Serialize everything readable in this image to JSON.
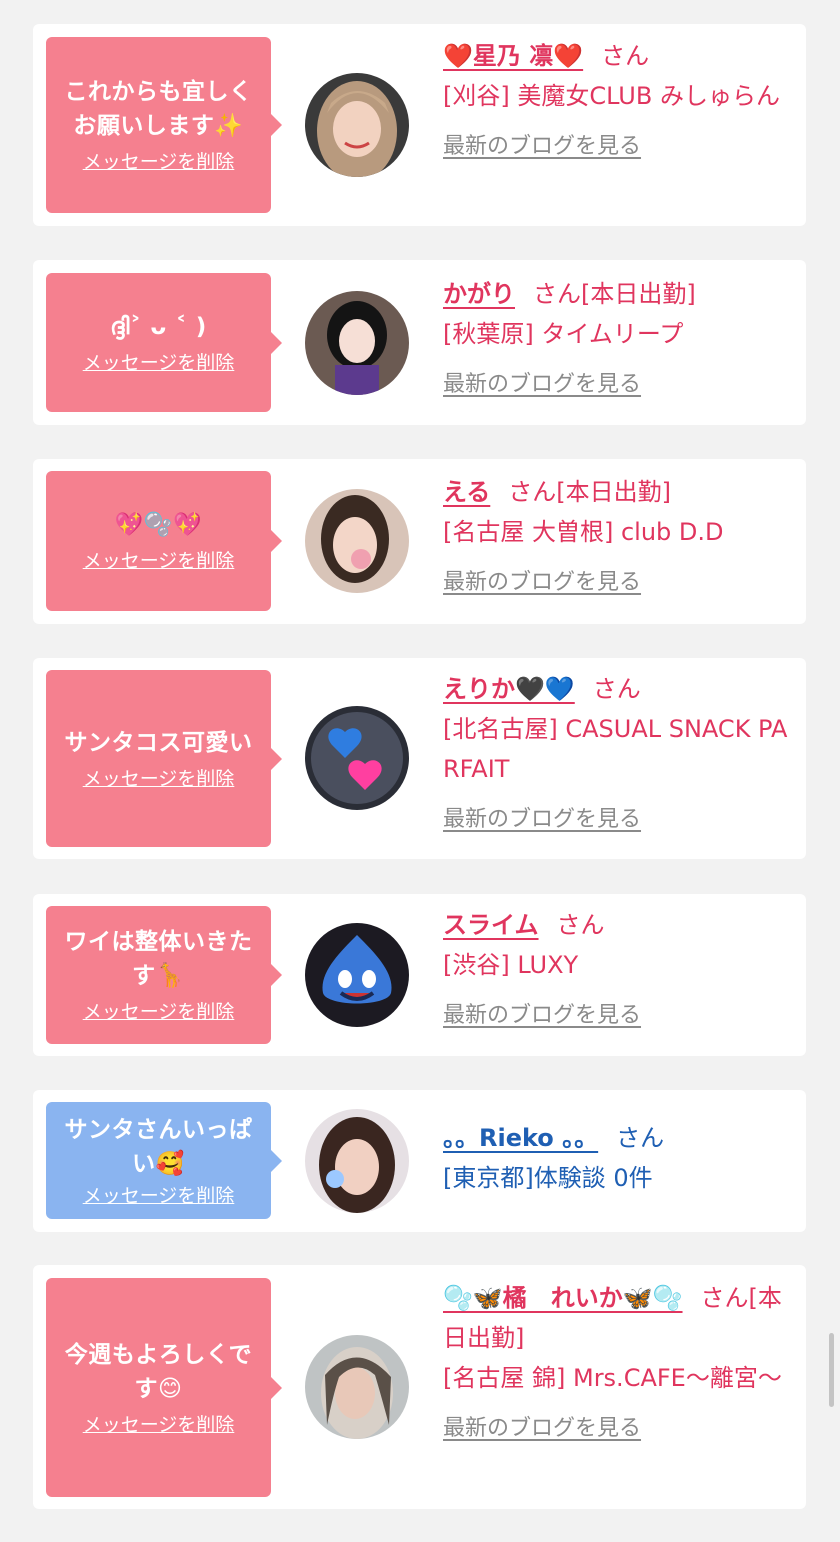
{
  "delete_label": "メッセージを削除",
  "blog_label": "最新のブログを見る",
  "san": "さん",
  "colors": {
    "pink_bubble": "#f5808f",
    "blue_bubble": "#8ab4f0",
    "name_pink": "#e0355e",
    "name_blue": "#1f5fb3",
    "link_gray": "#8a8a8a"
  },
  "cards": [
    {
      "message": "これからも宜しくお願いします✨",
      "name": "❤️星乃 凛❤️",
      "suffix": "",
      "shop": "[刈谷] 美魔女CLUB みしゅらん",
      "bubble_color": "pink"
    },
    {
      "message": "ദ്ദി˃ ᴗ ˂ )",
      "name": "かがり",
      "suffix": "[本日出勤]",
      "shop": "[秋葉原] タイムリープ",
      "bubble_color": "pink"
    },
    {
      "message": "💖🫧💖",
      "name": "える",
      "suffix": "[本日出勤]",
      "shop": "[名古屋 大曽根] club D.D",
      "bubble_color": "pink"
    },
    {
      "message": "サンタコス可愛い",
      "name": "えりか🖤💙",
      "suffix": "",
      "shop": "[北名古屋] CASUAL SNACK PARFAIT",
      "bubble_color": "pink"
    },
    {
      "message": "ワイは整体いきたす🦒",
      "name": "スライム",
      "suffix": "",
      "shop": "[渋谷] LUXY",
      "bubble_color": "pink"
    },
    {
      "message": "サンタさんいっぱい🥰",
      "name": "。。Rieko 。。",
      "suffix": "",
      "shop": "[東京都]体験談 0件",
      "bubble_color": "blue"
    },
    {
      "message": "今週もよろしくです😊",
      "name": "🫧🦋橘　れいか🦋🫧",
      "suffix": "[本日出勤]",
      "shop": "[名古屋 錦] Mrs.CAFE〜離宮〜",
      "bubble_color": "pink"
    }
  ]
}
